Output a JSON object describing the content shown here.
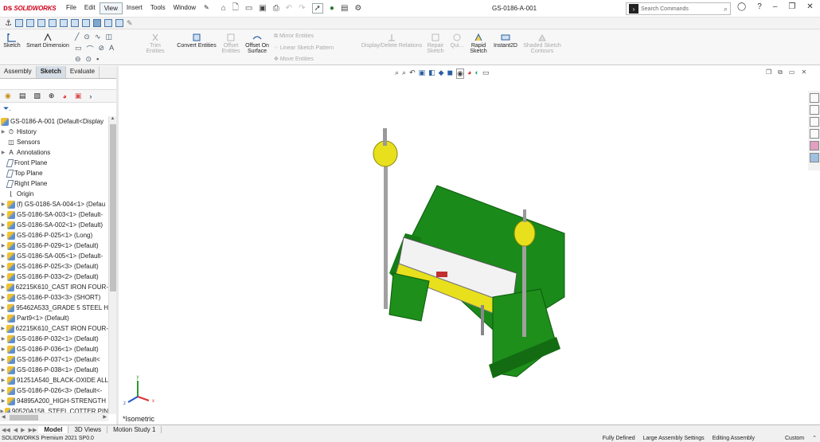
{
  "app": {
    "logo_text": "SOLIDWORKS",
    "doc_title": "GS-0186-A-001",
    "menu": [
      "File",
      "Edit",
      "View",
      "Insert",
      "Tools",
      "Window"
    ],
    "active_menu": "View",
    "search_placeholder": "Search Commands"
  },
  "commands": {
    "sketch": "Sketch",
    "smart_dimension": "Smart Dimension",
    "trim_entities": "Trim Entities",
    "convert_entities": "Convert Entities",
    "offset_entities_1": "Offset",
    "offset_entities_2": "Entities",
    "offset_on_surface_1": "Offset On",
    "offset_on_surface_2": "Surface",
    "mirror_entities": "Mirror Entities",
    "linear_sketch_pattern": "Linear Sketch Pattern",
    "move_entities": "Move Entities",
    "display_delete_relations": "Display/Delete Relations",
    "repair_1": "Repair",
    "repair_2": "Sketch",
    "quick": "Qui...",
    "rapid_1": "Rapid",
    "rapid_2": "Sketch",
    "instant2d": "Instant2D",
    "shaded_1": "Shaded Sketch",
    "shaded_2": "Contours"
  },
  "tabs": [
    "Assembly",
    "Sketch",
    "Evaluate"
  ],
  "active_tab": "Sketch",
  "tree": {
    "root": "GS-0186-A-001  (Default<Display",
    "items": [
      {
        "label": "History",
        "arrow": true,
        "icon": "history"
      },
      {
        "label": "Sensors",
        "arrow": false,
        "icon": "sensor"
      },
      {
        "label": "Annotations",
        "arrow": true,
        "icon": "annotation"
      },
      {
        "label": "Front Plane",
        "arrow": false,
        "icon": "plane"
      },
      {
        "label": "Top Plane",
        "arrow": false,
        "icon": "plane"
      },
      {
        "label": "Right Plane",
        "arrow": false,
        "icon": "plane"
      },
      {
        "label": "Origin",
        "arrow": false,
        "icon": "origin"
      },
      {
        "label": "(f) GS-0186-SA-004<1> (Defau",
        "arrow": true,
        "icon": "part"
      },
      {
        "label": "GS-0186-SA-003<1> (Default-",
        "arrow": true,
        "icon": "part"
      },
      {
        "label": "GS-0186-SA-002<1> (Default)",
        "arrow": true,
        "icon": "part"
      },
      {
        "label": "GS-0186-P-025<1> (Long)",
        "arrow": true,
        "icon": "part"
      },
      {
        "label": "GS-0186-P-029<1> (Default)",
        "arrow": true,
        "icon": "part"
      },
      {
        "label": "GS-0186-SA-005<1> (Default-",
        "arrow": true,
        "icon": "part"
      },
      {
        "label": "GS-0186-P-025<3> (Default)",
        "arrow": true,
        "icon": "part"
      },
      {
        "label": "GS-0186-P-033<2> (Default)",
        "arrow": true,
        "icon": "part"
      },
      {
        "label": "62215K610_CAST IRON FOUR-",
        "arrow": true,
        "icon": "part"
      },
      {
        "label": "GS-0186-P-033<3> (SHORT)",
        "arrow": true,
        "icon": "part"
      },
      {
        "label": "95462A533_GRADE 5 STEEL H",
        "arrow": true,
        "icon": "part"
      },
      {
        "label": "Part9<1> (Default)",
        "arrow": true,
        "icon": "part"
      },
      {
        "label": "62215K610_CAST IRON FOUR-",
        "arrow": true,
        "icon": "part"
      },
      {
        "label": "GS-0186-P-032<1> (Default)",
        "arrow": true,
        "icon": "part"
      },
      {
        "label": "GS-0186-P-036<1> (Default)",
        "arrow": true,
        "icon": "part"
      },
      {
        "label": "GS-0186-P-037<1> (Default<",
        "arrow": true,
        "icon": "part"
      },
      {
        "label": "GS-0186-P-038<1> (Default)",
        "arrow": true,
        "icon": "part"
      },
      {
        "label": "91251A540_BLACK-OXIDE ALL",
        "arrow": true,
        "icon": "part"
      },
      {
        "label": "GS-0186-P-026<3> (Default<-",
        "arrow": true,
        "icon": "part"
      },
      {
        "label": "94895A200_HIGH-STRENGTH",
        "arrow": true,
        "icon": "part"
      },
      {
        "label": "90520A158_STEEL COTTER PIN",
        "arrow": true,
        "icon": "part"
      }
    ]
  },
  "view": {
    "orientation_label": "*Isometric"
  },
  "bottom_tabs": [
    "Model",
    "3D Views",
    "Motion Study 1"
  ],
  "active_bottom_tab": "Model",
  "status": {
    "left": "SOLIDWORKS Premium 2021 SP0.0",
    "fully_defined": "Fully Defined",
    "large_assembly": "Large Assembly Settings",
    "editing": "Editing Assembly",
    "custom": "Custom"
  },
  "colors": {
    "model_green": "#1d8f1a",
    "model_dark_green": "#136b12",
    "model_yellow": "#e8e01c",
    "logo_red": "#d0021b",
    "accent_blue": "#1a5ca8"
  },
  "triad": {
    "x": "x",
    "y": "y",
    "z": "z"
  }
}
